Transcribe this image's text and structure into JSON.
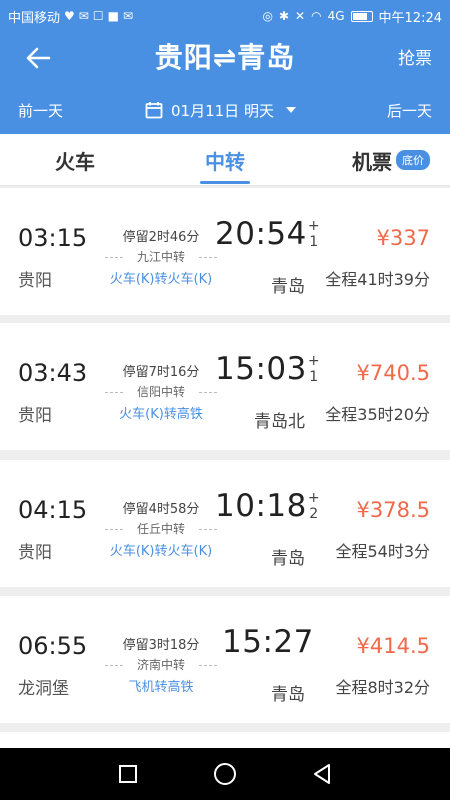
{
  "status_bar": {
    "carrier": "中国移动",
    "time": "中午12:24",
    "signal": "4G"
  },
  "header": {
    "title": "贵阳⇌青岛",
    "grab_ticket": "抢票",
    "prev_day": "前一天",
    "date": "01月11日 明天",
    "next_day": "后一天"
  },
  "tabs": {
    "train": "火车",
    "transfer": "中转",
    "flight": "机票",
    "flight_badge": "底价",
    "active": "中转"
  },
  "trips": [
    {
      "dep_time": "03:15",
      "dep_station": "贵阳",
      "stop": "停留2时46分",
      "transfer_city": "九江中转",
      "transfer_type": "火车(K)转火车(K)",
      "arr_time": "20:54",
      "plus_day": "+1",
      "arr_station": "青岛",
      "price": "¥337",
      "duration": "全程41时39分"
    },
    {
      "dep_time": "03:43",
      "dep_station": "贵阳",
      "stop": "停留7时16分",
      "transfer_city": "信阳中转",
      "transfer_type": "火车(K)转高铁",
      "arr_time": "15:03",
      "plus_day": "+1",
      "arr_station": "青岛北",
      "price": "¥740.5",
      "duration": "全程35时20分"
    },
    {
      "dep_time": "04:15",
      "dep_station": "贵阳",
      "stop": "停留4时58分",
      "transfer_city": "任丘中转",
      "transfer_type": "火车(K)转火车(K)",
      "arr_time": "10:18",
      "plus_day": "+2",
      "arr_station": "青岛",
      "price": "¥378.5",
      "duration": "全程54时3分"
    },
    {
      "dep_time": "06:55",
      "dep_station": "龙洞堡",
      "stop": "停留3时18分",
      "transfer_city": "济南中转",
      "transfer_type": "飞机转高铁",
      "arr_time": "15:27",
      "plus_day": "",
      "arr_station": "青岛",
      "price": "¥414.5",
      "duration": "全程8时32分"
    }
  ],
  "colors": {
    "accent": "#4a90e2",
    "price": "#f06a4a"
  },
  "icons": [
    "back-arrow-icon",
    "calendar-icon",
    "chevron-down-icon",
    "square-icon",
    "circle-icon",
    "triangle-back-icon"
  ]
}
